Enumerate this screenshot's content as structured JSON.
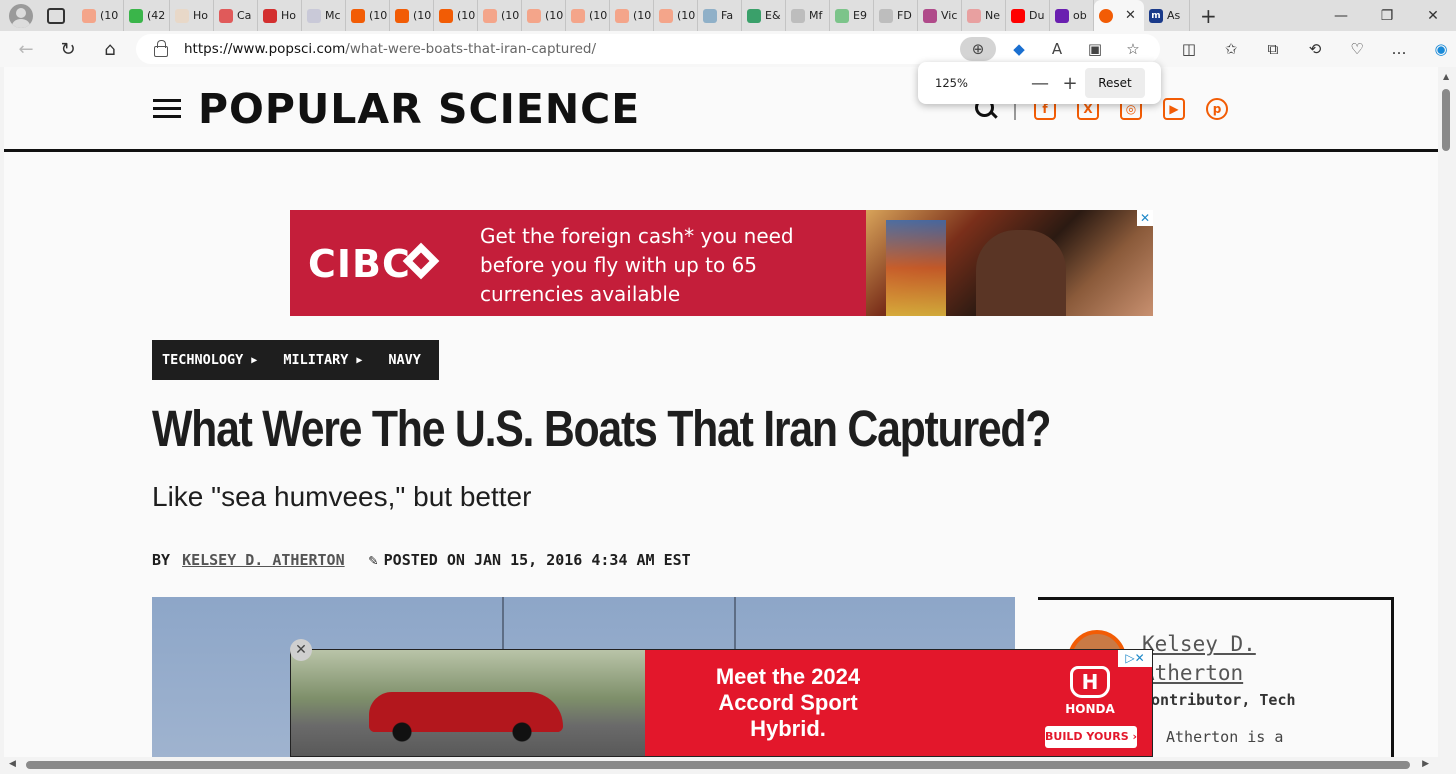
{
  "browser": {
    "tabs": [
      {
        "label": "(10",
        "color": "#f4a58a"
      },
      {
        "label": "(42",
        "color": "#3ab54a"
      },
      {
        "label": "Ho",
        "color": "#e8d8c8"
      },
      {
        "label": "Ca",
        "color": "#e05a5a"
      },
      {
        "label": "Ho",
        "color": "#d32f2f"
      },
      {
        "label": "Mc",
        "color": "#c9c9d8"
      },
      {
        "label": "(10",
        "color": "#f25c05"
      },
      {
        "label": "(10",
        "color": "#f25c05"
      },
      {
        "label": "(10",
        "color": "#f25c05"
      },
      {
        "label": "(10",
        "color": "#f4a58a"
      },
      {
        "label": "(10",
        "color": "#f4a58a"
      },
      {
        "label": "(10",
        "color": "#f4a58a"
      },
      {
        "label": "(10",
        "color": "#f4a58a"
      },
      {
        "label": "(10",
        "color": "#f4a58a"
      },
      {
        "label": "Fa",
        "color": "#8fb0c8"
      },
      {
        "label": "E&",
        "color": "#3aa06a"
      },
      {
        "label": "Mf",
        "color": "#bdbdbd"
      },
      {
        "label": "E9",
        "color": "#7cc48a"
      },
      {
        "label": "FD",
        "color": "#bdbdbd"
      },
      {
        "label": "Vic",
        "color": "#b04a8a"
      },
      {
        "label": "Ne",
        "color": "#e8a0a0"
      },
      {
        "label": "Du",
        "color": "#ff0000"
      },
      {
        "label": "ob",
        "color": "#6a1fb0"
      }
    ],
    "active_tab": {
      "label": "",
      "color": "#f25c05"
    },
    "last_tab": {
      "label": "As",
      "color": "#1a3a8a"
    },
    "url_domain": "https://www.popsci.com",
    "url_path": "/what-were-boats-that-iran-captured/",
    "zoom": {
      "level": "125%",
      "reset_label": "Reset"
    }
  },
  "site": {
    "logo": "POPULAR SCIENCE",
    "social_icons": [
      "facebook-icon",
      "x-icon",
      "instagram-icon",
      "youtube-icon",
      "pinterest-icon"
    ]
  },
  "ads": {
    "top": {
      "brand": "CIBC",
      "copy": "Get the foreign cash* you need before you fly with up to 65 currencies available"
    },
    "sticky": {
      "headline": "Meet the 2024 Accord Sport Hybrid.",
      "brand": "HONDA",
      "cta": "BUILD YOURS ›"
    }
  },
  "article": {
    "breadcrumbs": [
      "TECHNOLOGY",
      "MILITARY",
      "NAVY"
    ],
    "title": "What Were The U.S. Boats That Iran Captured?",
    "dek": "Like \"sea humvees,\" but better",
    "byline_prefix": "BY",
    "author": "KELSEY D. ATHERTON",
    "posted": "POSTED ON JAN 15, 2016 4:34 AM EST"
  },
  "author_card": {
    "name": "Kelsey D. Atherton",
    "role": "Contributor, Tech",
    "bio_start": "Atherton is a"
  }
}
